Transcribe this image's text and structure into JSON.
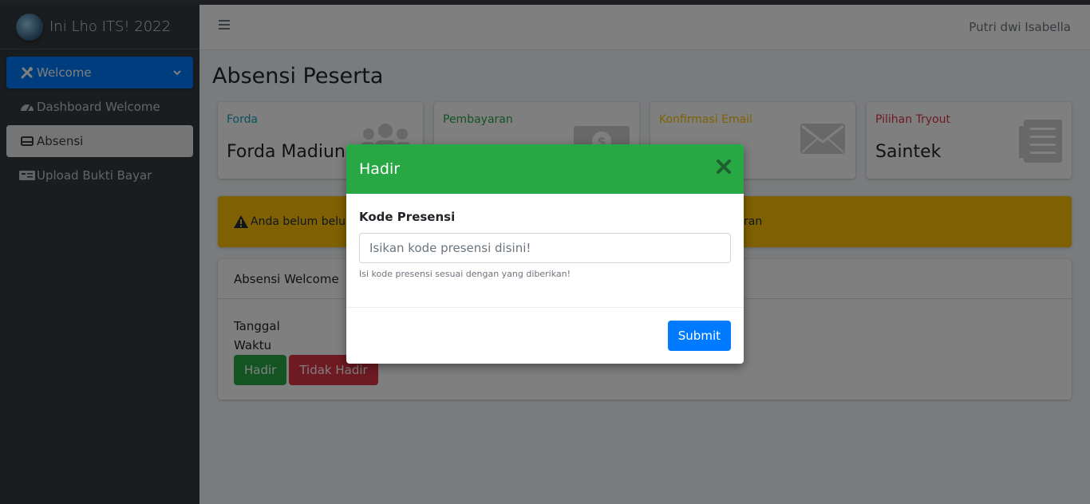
{
  "brand": {
    "title": "Ini Lho ITS! 2022"
  },
  "sidebar": {
    "items": [
      {
        "label": "Welcome",
        "icon": "tools-icon"
      },
      {
        "label": "Dashboard Welcome",
        "icon": "dashboard-gauge-icon"
      },
      {
        "label": "Absensi",
        "icon": "card-icon"
      },
      {
        "label": "Upload Bukti Bayar",
        "icon": "money-check-icon"
      }
    ]
  },
  "header": {
    "username": "Putri dwi Isabella"
  },
  "page": {
    "title": "Absensi Peserta"
  },
  "info_boxes": [
    {
      "label": "Forda",
      "value": "Forda Madiun",
      "label_color": "#17a2b8",
      "icon": "users-icon"
    },
    {
      "label": "Pembayaran",
      "value": "",
      "label_color": "#28a745",
      "icon": "money-bill-icon"
    },
    {
      "label": "Konfirmasi Email",
      "value": "",
      "label_color": "#ffc107",
      "icon": "envelope-icon"
    },
    {
      "label": "Pilihan Tryout",
      "value": "Saintek",
      "label_color": "#dc3545",
      "icon": "list-icon"
    }
  ],
  "alert": {
    "text_left": "Anda belum belum",
    "text_right": "ran",
    "icon": "warning-icon"
  },
  "card": {
    "title": "Absensi Welcome",
    "rows": [
      "Tanggal",
      "Waktu"
    ],
    "btn_hadir": "Hadir",
    "btn_tidak_hadir": "Tidak Hadir"
  },
  "modal": {
    "title": "Hadir",
    "field_label": "Kode Presensi",
    "field_placeholder": "Isikan kode presensi disini!",
    "field_value": "",
    "field_help": "Isi kode presensi sesuai dengan yang diberikan!",
    "submit_label": "Submit"
  }
}
